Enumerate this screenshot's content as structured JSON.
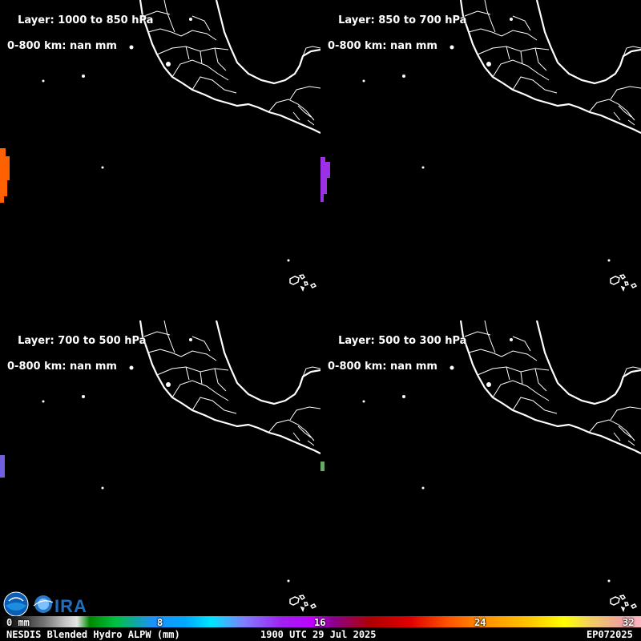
{
  "panels": [
    {
      "layer": "Layer: 1000 to 850 hPa",
      "range": "0-800 km: nan mm",
      "patch_color": "#ff6000"
    },
    {
      "layer": "Layer: 850 to 700 hPa",
      "range": "0-800 km: nan mm",
      "patch_color": "#9b30e6"
    },
    {
      "layer": "Layer: 700 to 500 hPa",
      "range": "0-800 km: nan mm",
      "patch_color": "#7060e0"
    },
    {
      "layer": "Layer: 500 to 300 hPa",
      "range": "0-800 km: nan mm",
      "patch_color": "#6aa86a"
    }
  ],
  "colorbar": {
    "ticks": [
      "0 mm",
      "8",
      "16",
      "24",
      "32"
    ]
  },
  "footer": {
    "product": "NESDIS Blended Hydro ALPW (mm)",
    "time": "1900 UTC 29 Jul 2025",
    "storm_id": "EP072025"
  },
  "colors": {
    "background": "#000000",
    "coastline": "#ffffff"
  }
}
